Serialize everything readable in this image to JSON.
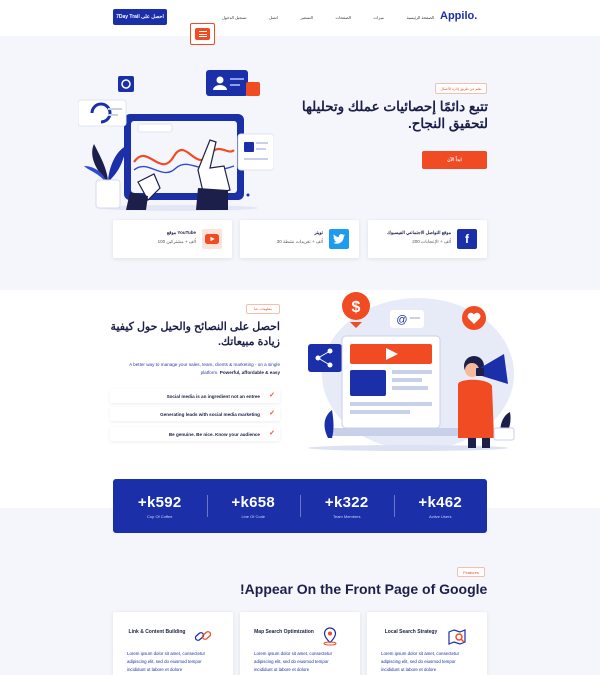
{
  "nav": {
    "cta": "7Day Trail احصل على",
    "logo": "Appilo.",
    "links": [
      "الصفحة الرئيسية",
      "ميزات",
      "الصفحات",
      "التسعير",
      "اتصل",
      "تسجيل الدخول"
    ]
  },
  "hero": {
    "badge": "تعلم عن طريق إدارة الأعمال",
    "title": "تتبع دائمًا إحصائيات عملك وتحليلها لتحقيق النجاح.",
    "button": "ابدأ الآن"
  },
  "social": [
    {
      "name": "موقع التواصل الاجتماعي الفيسبوك",
      "stat": "200 ألف + الإعجابات",
      "icon": "facebook-icon",
      "color": "#1a2fa8",
      "glyph": "f"
    },
    {
      "name": "تويتر",
      "stat": "30 ألف + تغريدات نشطة",
      "icon": "twitter-icon",
      "color": "#1d9bf0",
      "glyph": "t"
    },
    {
      "name": "موقع YouTube",
      "stat": "100 ألف + مشتركين",
      "icon": "youtube-icon",
      "color": "#f04b23",
      "glyph": "▶"
    }
  ],
  "about": {
    "badge": "معلومات عنا",
    "title": "احصل على النصائح والحيل حول كيفية زيادة مبيعاتك.",
    "desc": "A better way to manage your sales, team, clients & marketing - on a single platform.",
    "desc_bold": "Powerful, affordable & easy",
    "items": [
      "Social media is an ingredient not an entree",
      "Generating leads with social media marketing",
      "Be genuine. Be nice. Know your audience"
    ]
  },
  "counters": [
    {
      "num": "+k592",
      "label": "Cup Of Coffee"
    },
    {
      "num": "+k658",
      "label": "Line Of Code"
    },
    {
      "num": "+k322",
      "label": "Team Members"
    },
    {
      "num": "+k462",
      "label": "Active Users"
    }
  ],
  "features": {
    "badge": "Features",
    "title": "!Appear On the Front Page of Google",
    "cards": [
      {
        "title": "Local Search Strategy",
        "desc": "Lorem ipsum dolor sit amet, consectetur adipiscing elit, sed do eiusmod tempor incididunt ut labore et dolore",
        "icon": "map-search-icon"
      },
      {
        "title": "Map Search Optimization",
        "desc": "Lorem ipsum dolor sit amet, consectetur adipiscing elit, sed do eiusmod tempor incididunt ut labore et dolore",
        "icon": "location-pin-icon"
      },
      {
        "title": "Link & Content Building",
        "desc": "Lorem ipsum dolor sit amet, consectetur adipiscing elit, sed do eiusmod tempor incididunt ut labore et dolore",
        "icon": "link-icon"
      }
    ]
  },
  "colors": {
    "primary": "#1a2fa8",
    "accent": "#f04b23",
    "text": "#1c1f4a",
    "section_bg": "#f4f6fb"
  }
}
